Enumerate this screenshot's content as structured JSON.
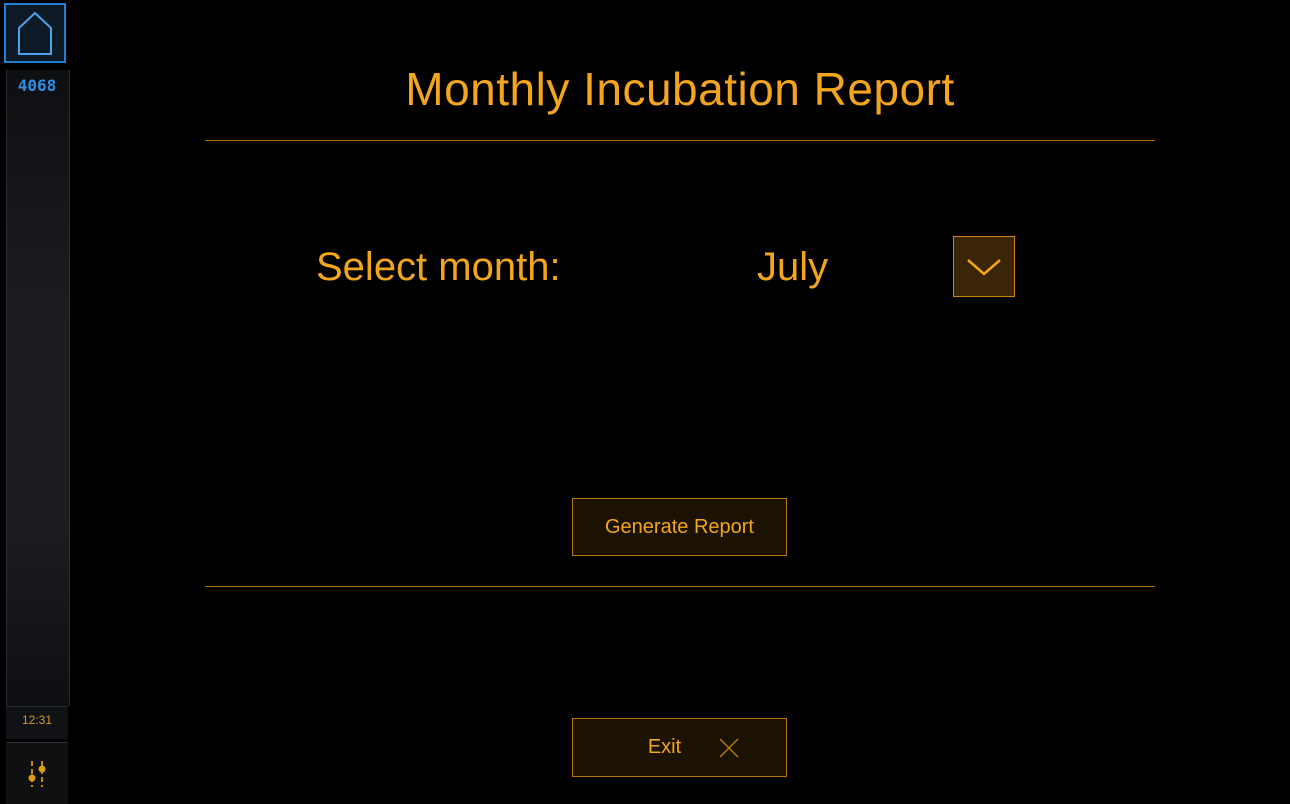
{
  "sidebar": {
    "home_icon": "home-icon",
    "count": "4068",
    "time": "12:31",
    "settings_icon": "sliders-icon"
  },
  "header": {
    "title": "Monthly Incubation Report"
  },
  "form": {
    "select_label": "Select month:",
    "selected_month": "July",
    "dropdown_icon": "chevron-down-icon"
  },
  "actions": {
    "generate_label": "Generate Report",
    "exit_label": "Exit",
    "exit_icon": "close-icon"
  },
  "colors": {
    "accent": "#f2a51d",
    "home_border": "#1e7fd6",
    "count_text": "#2d8fe6",
    "background": "#000000"
  }
}
